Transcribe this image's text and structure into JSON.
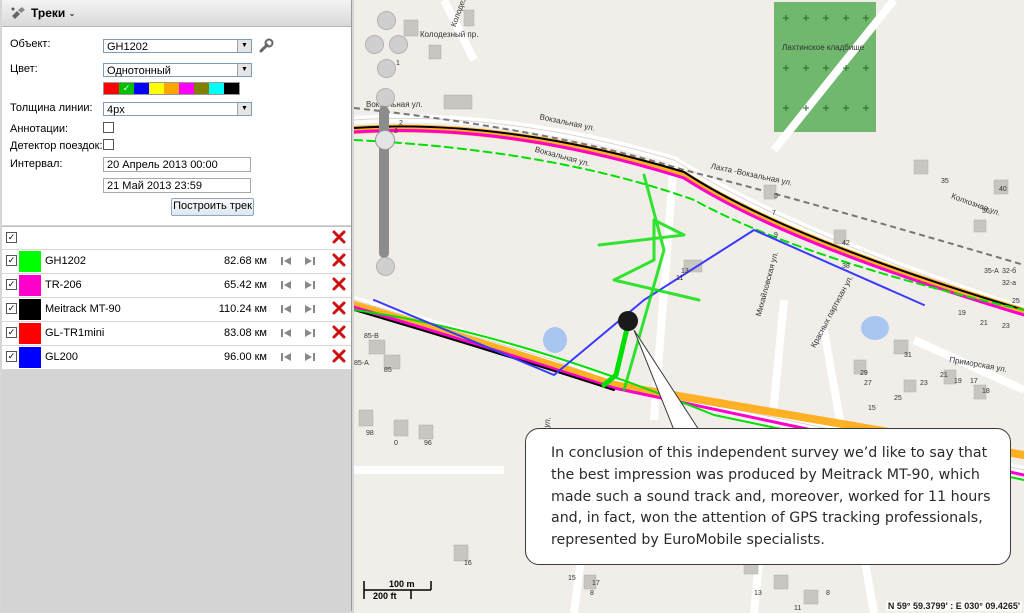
{
  "panel": {
    "title": "Треки",
    "object_label": "Объект:",
    "object_value": "GH1202",
    "color_label": "Цвет:",
    "color_value": "Однотонный",
    "palette": [
      "#ff0000",
      "#00c000",
      "#0000ff",
      "#ffff00",
      "#ffa500",
      "#ff00ff",
      "#808000",
      "#00ffff",
      "#000000"
    ],
    "line_width_label": "Толщина линии:",
    "line_width_value": "4px",
    "annotations_label": "Аннотации:",
    "trip_detector_label": "Детектор поездок:",
    "interval_label": "Интервал:",
    "date_from": "20 Апрель 2013 00:00",
    "date_to": "21 Май 2013 23:59",
    "build_button": "Построить трек"
  },
  "tracks": [
    {
      "name": "GH1202",
      "distance": "82.68 км",
      "color": "#00ff00"
    },
    {
      "name": "TR-206",
      "distance": "65.42 км",
      "color": "#ff00cc"
    },
    {
      "name": "Meitrack MT-90",
      "distance": "110.24 км",
      "color": "#000000"
    },
    {
      "name": "GL-TR1mini",
      "distance": "83.08 км",
      "color": "#ff0000"
    },
    {
      "name": "GL200",
      "distance": "96.00 км",
      "color": "#0000ff"
    }
  ],
  "map": {
    "streets": {
      "kolodezny_1": "Колодезный пр.",
      "kolodezny_2": "Колодезный пр.",
      "vokzalnaya_1": "Вокзальная ул.",
      "vokzalnaya_2": "Вокзальная ул.",
      "vokzalnaya_3": "Вокзальная ул.",
      "lakhta_vokzalnaya": "Лахта -Вокзальная ул.",
      "kolkhoznaya": "Колхозная ул.",
      "mikhailovskaya": "Михайловская ул.",
      "krasnykh_partizan": "Красных партизан ул.",
      "primorskaya": "Приморская ул.",
      "lakhta_cemetery": "Лахтинское кладбище",
      "borovaya": "Боровая ул."
    },
    "house_numbers": [
      "1",
      "3",
      "2",
      "2",
      "5",
      "7",
      "9",
      "11",
      "13",
      "35",
      "40",
      "36",
      "42",
      "38",
      "35-А",
      "32-б",
      "32-а",
      "25",
      "23",
      "21",
      "19",
      "31",
      "29",
      "27",
      "25",
      "23",
      "21",
      "19",
      "17",
      "18",
      "15",
      "8",
      "8",
      "85",
      "85-В",
      "85-А",
      "96",
      "98",
      "0",
      "16",
      "15",
      "17",
      "13",
      "11"
    ],
    "scale_top": "100 m",
    "scale_bottom": "200 ft",
    "coordinates": "N 59° 59.3799' : E 030° 09.4265'"
  },
  "callout_text": "In conclusion of this independent survey we’d like to say that the best impression was produced by Meitrack MT-90, which made such a sound track and, moreover, worked for 11 hours and, in fact, won the attention of GPS tracking professionals, represented by EuroMobile specialists."
}
